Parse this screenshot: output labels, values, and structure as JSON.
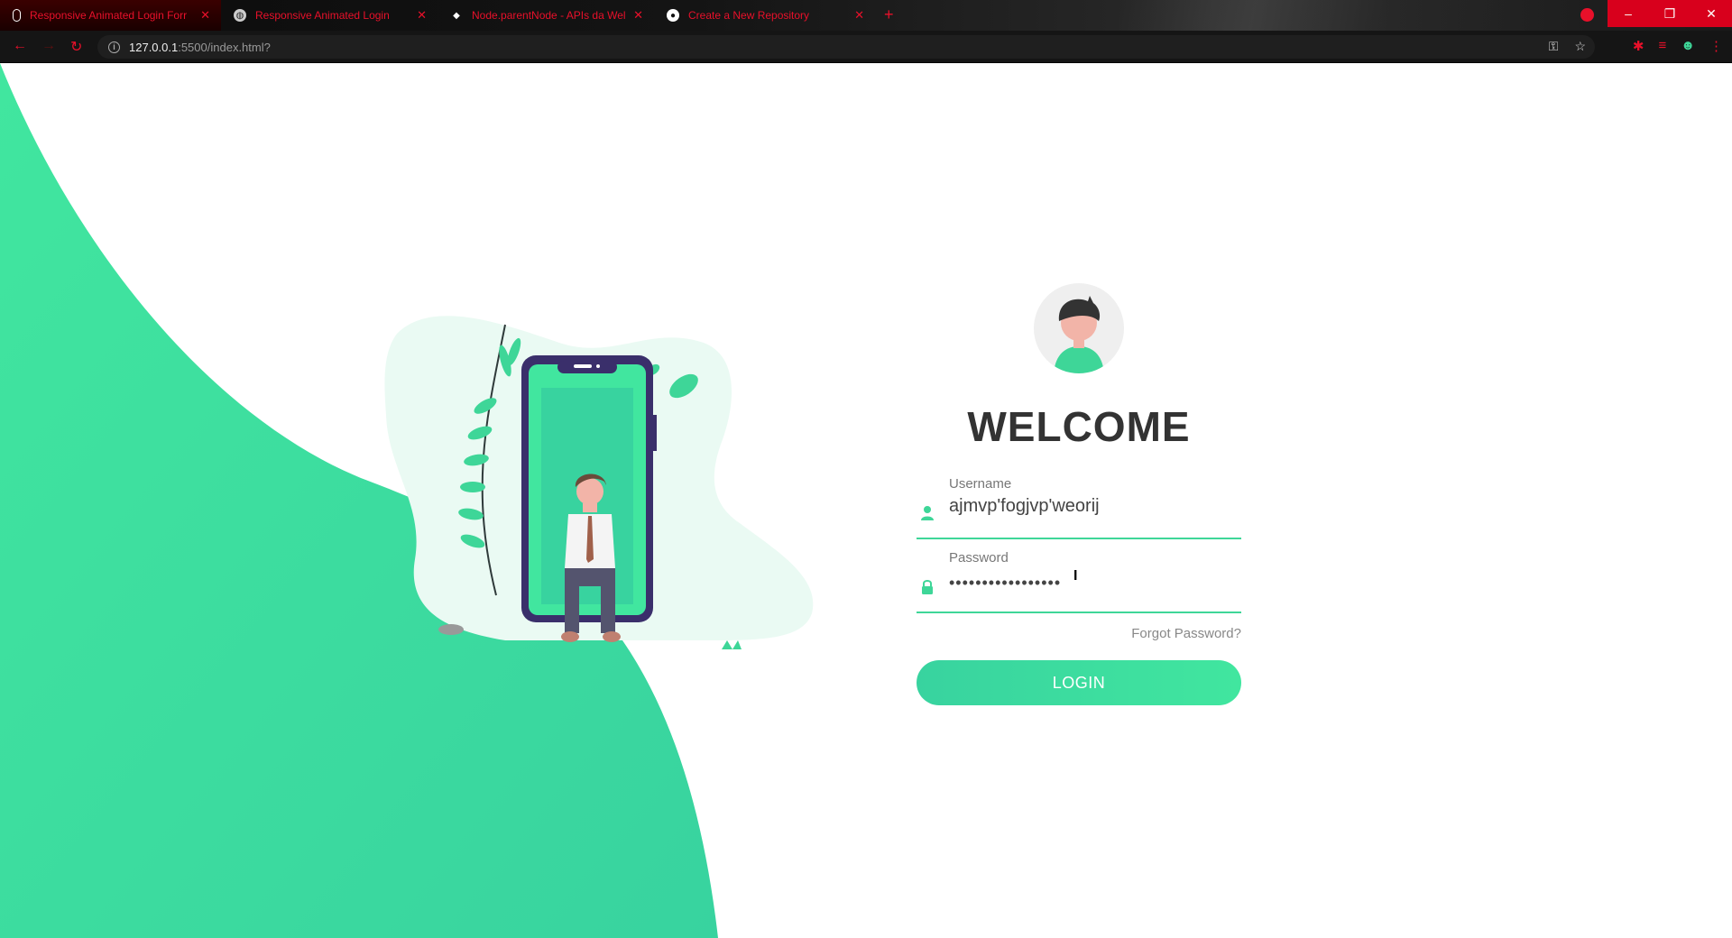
{
  "browser": {
    "tabs": [
      {
        "title": "Responsive Animated Login Forr",
        "icon": "microphone-icon",
        "active": true
      },
      {
        "title": "Responsive Animated Login",
        "icon": "globe-icon",
        "active": false
      },
      {
        "title": "Node.parentNode - APIs da Wel",
        "icon": "mdn-icon",
        "active": false
      },
      {
        "title": "Create a New Repository",
        "icon": "github-icon",
        "active": false
      }
    ],
    "new_tab": "+",
    "window_controls": {
      "minimize": "–",
      "restore": "❐",
      "close": "✕"
    },
    "url_host": "127.0.0.1",
    "url_path": ":5500/index.html?",
    "accent": "#e8102a"
  },
  "login": {
    "title": "WELCOME",
    "username": {
      "label": "Username",
      "value": "ajmvp'fogjvp'weorij",
      "icon": "user-icon"
    },
    "password": {
      "label": "Password",
      "value": "•••••••••••••••••",
      "icon": "lock-icon"
    },
    "forgot": "Forgot Password?",
    "button": "LOGIN"
  },
  "colors": {
    "primary": "#38d39f",
    "primary_light": "#41e69f",
    "blob": "#eafaf3",
    "phone": "#3a2f6b"
  }
}
